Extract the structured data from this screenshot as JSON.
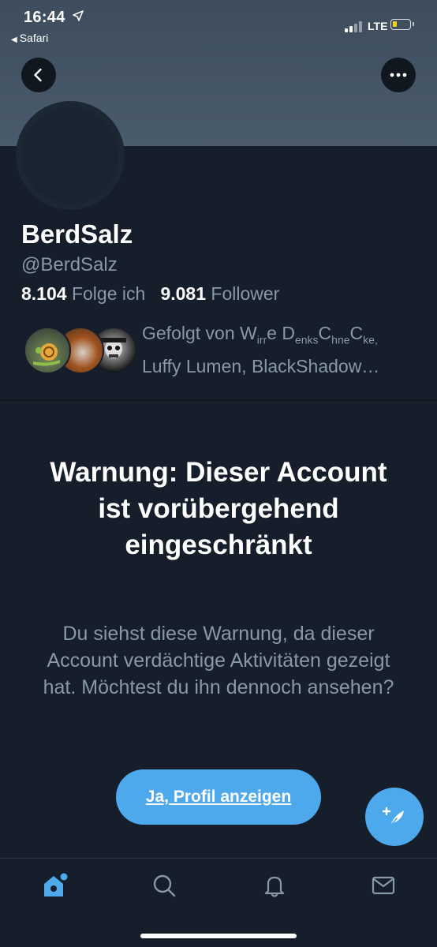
{
  "status_bar": {
    "time": "16:44",
    "back_app": "Safari",
    "network": "LTE",
    "battery_level": 0.2,
    "battery_color": "#f5d400"
  },
  "header": {
    "back_icon": "chevron-left-icon",
    "more_icon": "more-horizontal-icon"
  },
  "profile": {
    "name": "BerdSalz",
    "handle": "@BerdSalz",
    "following_count": "8.104",
    "following_label": "Folge ich",
    "followers_count": "9.081",
    "followers_label": "Follower",
    "followed_by_prefix": "Gefolgt von W",
    "followed_by_sub1": "irr",
    "followed_by_e": "e D",
    "followed_by_sub2": "enks",
    "followed_by_c": "C",
    "followed_by_sub3": "hne",
    "followed_by_cke": "C",
    "followed_by_sub4": "ke,",
    "followed_by_line2": "Luffy Lumen, BlackShadow…"
  },
  "warning": {
    "title": "Warnung: Dieser Account ist vorübergehend eingeschränkt",
    "text": "Du siehst diese Warnung, da dieser Account verdächtige Aktivitäten gezeigt hat. Möchtest du ihn dennoch ansehen?",
    "button_label": "Ja, Profil anzeigen"
  },
  "tabbar": {
    "items": [
      "home-icon",
      "search-icon",
      "notifications-icon",
      "messages-icon"
    ],
    "active_color": "#4ea8ec",
    "inactive_color": "#8899a6"
  },
  "colors": {
    "background": "#151e2a",
    "accent": "#4ea8ec",
    "secondary_text": "#8899a6"
  }
}
